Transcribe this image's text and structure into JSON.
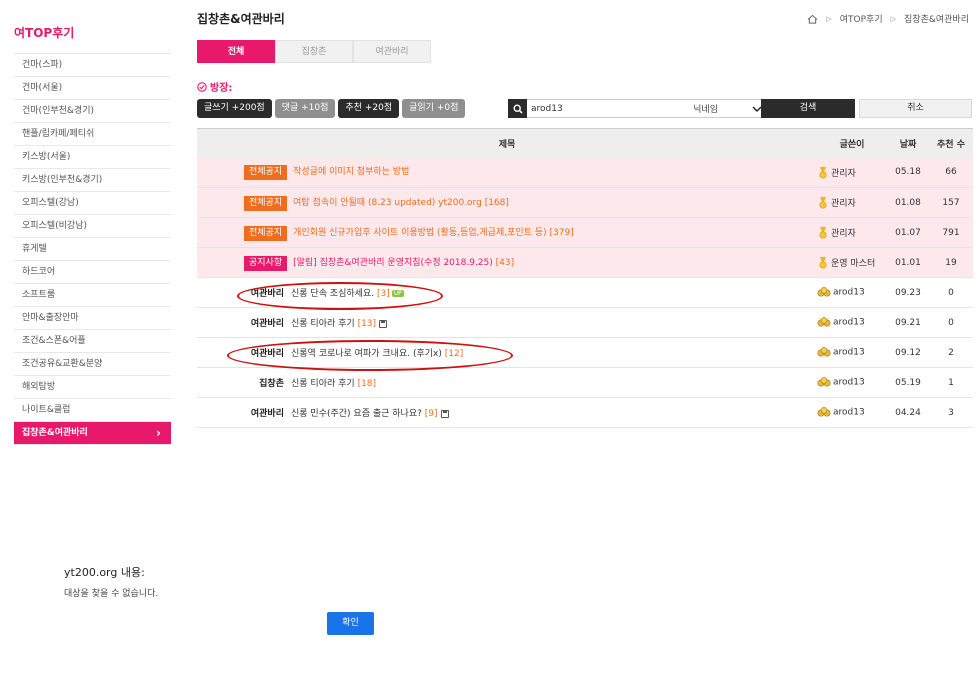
{
  "sidebar": {
    "title": "여TOP후기",
    "items": [
      "건마(스파)",
      "건마(서울)",
      "건마(인부천&경기)",
      "핸플/립카페/페티쉬",
      "키스방(서울)",
      "키스방(인부천&경기)",
      "오피스텔(강남)",
      "오피스텔(비강남)",
      "휴게텔",
      "하드코어",
      "소프트룸",
      "안마&출장안마",
      "조건&스폰&어플",
      "조건공유&교환&분양",
      "해외탐방",
      "나이트&클럽",
      "집창촌&여관바리"
    ],
    "active_chevron": "›"
  },
  "header": {
    "title": "집창촌&여관바리",
    "breadcrumb": [
      "여TOP후기",
      "집창촌&여관바리"
    ]
  },
  "tabs": [
    "전체",
    "집창촌",
    "여관바리"
  ],
  "banjang": "방장:",
  "points": [
    "글쓰기 +200점",
    "댓글 +10점",
    "추천 +20점",
    "글읽기 +0점"
  ],
  "search": {
    "value": "arod13",
    "select": "닉네임",
    "search_label": "검색",
    "cancel_label": "취소"
  },
  "table": {
    "headers": {
      "title": "제목",
      "author": "글쓴이",
      "date": "날짜",
      "rec": "추천 수"
    },
    "notices": [
      {
        "badge": "전체공지",
        "title": "작성글에 이미지 첨부하는 방법",
        "comments": "",
        "author": "관리자",
        "date": "05.18",
        "rec": "66"
      },
      {
        "badge": "전체공지",
        "title": "여탑 접속이 안될때 (8.23 updated) yt200.org",
        "comments": "[168]",
        "author": "관리자",
        "date": "01.08",
        "rec": "157"
      },
      {
        "badge": "전체공지",
        "title": "개인회원 신규가입후 사이트 이용방법 (활동,등업,게급제,포인트 등)",
        "comments": "[379]",
        "author": "관리자",
        "date": "01.07",
        "rec": "791"
      },
      {
        "badge": "공지사항",
        "title": "[알림] 집창촌&여관바리 운영지침(수정 2018.9.25)",
        "comments": "[43]",
        "author": "운영 마스터",
        "date": "01.01",
        "rec": "19"
      }
    ],
    "posts": [
      {
        "cat": "여관바리",
        "title": "신롱 단속 조심하세요.",
        "comments": "[3]",
        "extra": "up",
        "author": "arod13",
        "date": "09.23",
        "rec": "0"
      },
      {
        "cat": "여관바리",
        "title": "신롱 티아라 후기",
        "comments": "[13]",
        "extra": "disk",
        "author": "arod13",
        "date": "09.21",
        "rec": "0"
      },
      {
        "cat": "여관바리",
        "title": "신롱역 코로나로 여파가 크내요. (후기x)",
        "comments": "[12]",
        "extra": "",
        "author": "arod13",
        "date": "09.12",
        "rec": "2"
      },
      {
        "cat": "집창촌",
        "title": "신롱 티아라 후기",
        "comments": "[18]",
        "extra": "",
        "author": "arod13",
        "date": "05.19",
        "rec": "1"
      },
      {
        "cat": "여관바리",
        "title": "신롱 민수(주간) 요즘 출근 하나요?",
        "comments": "[9]",
        "extra": "disk",
        "author": "arod13",
        "date": "04.24",
        "rec": "3"
      }
    ],
    "up_badge": "UP"
  },
  "dialog": {
    "title": "yt200.org 내용:",
    "message": "대상을 찾을 수 없습니다.",
    "ok_label": "확인"
  },
  "colors": {
    "accent": "#e8196b",
    "notice_orange": "#f06d1e",
    "ok_blue": "#1a73e8",
    "ellipse": "#cc1111"
  }
}
